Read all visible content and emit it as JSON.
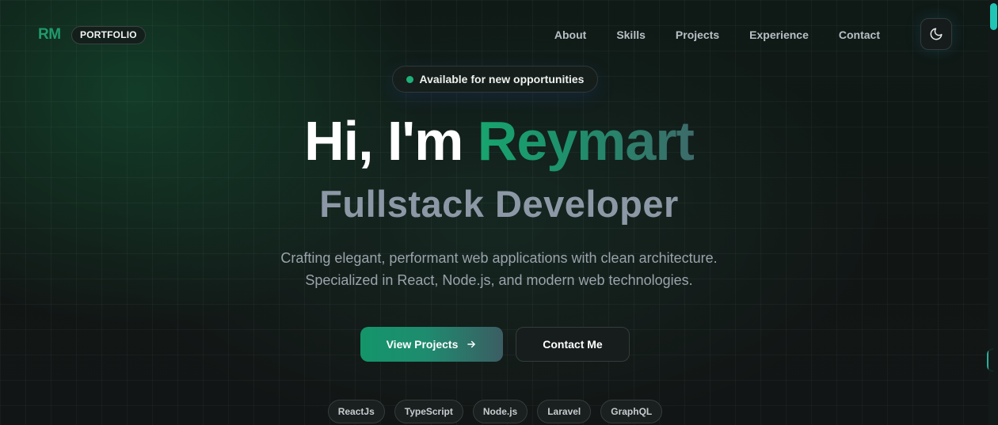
{
  "header": {
    "logo": "RM",
    "badge": "PORTFOLIO",
    "nav": [
      {
        "label": "About"
      },
      {
        "label": "Skills"
      },
      {
        "label": "Projects"
      },
      {
        "label": "Experience"
      },
      {
        "label": "Contact"
      }
    ],
    "theme_toggle_icon": "moon-icon"
  },
  "hero": {
    "status": "Available for new opportunities",
    "greeting": "Hi, I'm",
    "name": "Reymart",
    "role": "Fullstack Developer",
    "description_line1": "Crafting elegant, performant web applications with clean architecture.",
    "description_line2": "Specialized in React, Node.js, and modern web technologies.",
    "primary_button": "View Projects",
    "primary_button_icon": "arrow-right-icon",
    "secondary_button": "Contact Me",
    "tech_tags": [
      "ReactJs",
      "TypeScript",
      "Node.js",
      "Laravel",
      "GraphQL"
    ]
  },
  "colors": {
    "accent": "#1f9a6d",
    "background": "#0f1413",
    "status_dot": "#1fb07a"
  }
}
